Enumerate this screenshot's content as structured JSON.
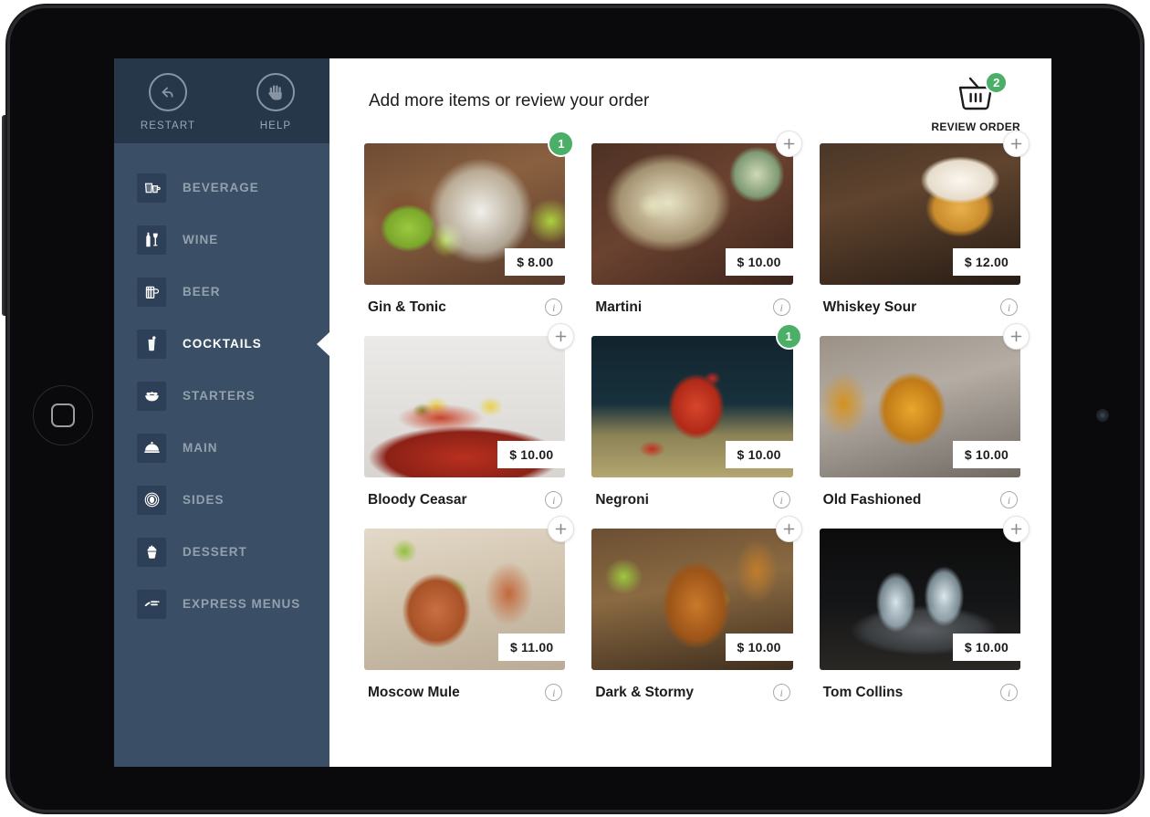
{
  "sidebar": {
    "top_actions": [
      {
        "label": "RESTART",
        "icon": "restart-arrow-icon"
      },
      {
        "label": "HELP",
        "icon": "raised-hand-icon"
      }
    ],
    "menu_items": [
      {
        "label": "BEVERAGE",
        "icon": "beverage-glass-icon",
        "active": false
      },
      {
        "label": "WINE",
        "icon": "wine-bottle-glass-icon",
        "active": false
      },
      {
        "label": "BEER",
        "icon": "beer-mug-icon",
        "active": false
      },
      {
        "label": "COCKTAILS",
        "icon": "cocktail-glass-icon",
        "active": true
      },
      {
        "label": "STARTERS",
        "icon": "salad-bowl-icon",
        "active": false
      },
      {
        "label": "MAIN",
        "icon": "cloche-dish-icon",
        "active": false
      },
      {
        "label": "SIDES",
        "icon": "bowl-circle-icon",
        "active": false
      },
      {
        "label": "DESSERT",
        "icon": "cupcake-icon",
        "active": false
      },
      {
        "label": "EXPRESS MENUS",
        "icon": "express-menu-icon",
        "active": false
      }
    ]
  },
  "header": {
    "title": "Add more items or review your order",
    "review_order_label": "REVIEW ORDER",
    "cart_count": "2",
    "cart_icon": "shopping-basket-icon"
  },
  "colors": {
    "sidebar_body": "#3a4f66",
    "sidebar_header": "#263749",
    "menu_icon_tile": "#2e4057",
    "badge_green": "#4caf68",
    "text_dark": "#1c1c1c",
    "menu_label": "#93a0ad"
  },
  "products": [
    {
      "name": "Gin & Tonic",
      "price": "$ 8.00",
      "quantity": "1",
      "has_quantity": true,
      "image_class": "img-gintonic",
      "info_label": "i"
    },
    {
      "name": "Martini",
      "price": "$ 10.00",
      "quantity": "",
      "has_quantity": false,
      "image_class": "img-martini",
      "info_label": "i"
    },
    {
      "name": "Whiskey Sour",
      "price": "$ 12.00",
      "quantity": "",
      "has_quantity": false,
      "image_class": "img-whiskeysour",
      "info_label": "i"
    },
    {
      "name": "Bloody Ceasar",
      "price": "$ 10.00",
      "quantity": "",
      "has_quantity": false,
      "image_class": "img-bloody",
      "info_label": "i"
    },
    {
      "name": "Negroni",
      "price": "$ 10.00",
      "quantity": "1",
      "has_quantity": true,
      "image_class": "img-negroni",
      "info_label": "i"
    },
    {
      "name": "Old Fashioned",
      "price": "$ 10.00",
      "quantity": "",
      "has_quantity": false,
      "image_class": "img-oldfashioned",
      "info_label": "i"
    },
    {
      "name": "Moscow Mule",
      "price": "$ 11.00",
      "quantity": "",
      "has_quantity": false,
      "image_class": "img-moscowmule",
      "info_label": "i"
    },
    {
      "name": "Dark & Stormy",
      "price": "$ 10.00",
      "quantity": "",
      "has_quantity": false,
      "image_class": "img-darkstormy",
      "info_label": "i"
    },
    {
      "name": "Tom Collins",
      "price": "$ 10.00",
      "quantity": "",
      "has_quantity": false,
      "image_class": "img-tomcollins",
      "info_label": "i"
    }
  ]
}
